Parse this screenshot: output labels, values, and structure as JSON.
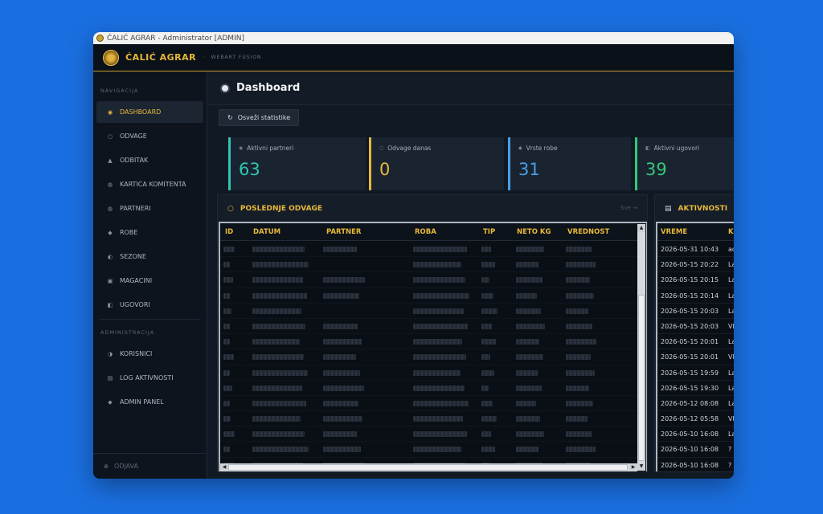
{
  "window": {
    "title": "ĆALIĆ AGRAR - Administrator [ADMIN]"
  },
  "header": {
    "brand": "ĆALIĆ AGRAR",
    "separator": "·",
    "subtitle": "WEBART FUSION"
  },
  "sidebar": {
    "section_nav": "NAVIGACIJA",
    "nav_items": [
      {
        "label": "DASHBOARD",
        "icon": "◉",
        "active": true
      },
      {
        "label": "ODVAGE",
        "icon": "○"
      },
      {
        "label": "ODBITAK",
        "icon": "▲"
      },
      {
        "label": "KARTICA KOMITENTA",
        "icon": "◍"
      },
      {
        "label": "PARTNERI",
        "icon": "◍"
      },
      {
        "label": "ROBE",
        "icon": "◆"
      },
      {
        "label": "SEZONE",
        "icon": "◐"
      },
      {
        "label": "MAGACINI",
        "icon": "▣"
      },
      {
        "label": "UGOVORI",
        "icon": "◧"
      }
    ],
    "section_admin": "ADMINISTRACIJA",
    "admin_items": [
      {
        "label": "KORISNICI",
        "icon": "◑"
      },
      {
        "label": "LOG AKTIVNOSTI",
        "icon": "▤"
      },
      {
        "label": "ADMIN PANEL",
        "icon": "◆"
      }
    ],
    "logout": "ODJAVA"
  },
  "page": {
    "title": "Dashboard",
    "refresh_label": "Osveži statistike"
  },
  "stats": [
    {
      "label": "Aktivni partneri",
      "value": "63",
      "color": "#2fc4b2"
    },
    {
      "label": "Odvage danas",
      "value": "0",
      "color": "#e8b83a"
    },
    {
      "label": "Vrste robe",
      "value": "31",
      "color": "#4a9ee8"
    },
    {
      "label": "Aktivni ugovori",
      "value": "39",
      "color": "#34c77b"
    }
  ],
  "recent_panel": {
    "title": "POSLEDNJE ODVAGE",
    "more": "Sve →",
    "columns": [
      "ID",
      "DATUM",
      "PARTNER",
      "ROBA",
      "TIP",
      "NETO KG",
      "VREDNOST"
    ]
  },
  "activity_panel": {
    "title": "AKTIVNOSTI",
    "columns": [
      "VREME",
      "K"
    ],
    "rows": [
      {
        "time": "2026-05-31 10:43",
        "user": "ad"
      },
      {
        "time": "2026-05-15 20:22",
        "user": "La"
      },
      {
        "time": "2026-05-15 20:15",
        "user": "La"
      },
      {
        "time": "2026-05-15 20:14",
        "user": "La"
      },
      {
        "time": "2026-05-15 20:03",
        "user": "La"
      },
      {
        "time": "2026-05-15 20:03",
        "user": "Vla"
      },
      {
        "time": "2026-05-15 20:01",
        "user": "La"
      },
      {
        "time": "2026-05-15 20:01",
        "user": "Vla"
      },
      {
        "time": "2026-05-15 19:59",
        "user": "La"
      },
      {
        "time": "2026-05-15 19:30",
        "user": "La"
      },
      {
        "time": "2026-05-12 08:08",
        "user": "La"
      },
      {
        "time": "2026-05-12 05:58",
        "user": "Vla"
      },
      {
        "time": "2026-05-10 16:08",
        "user": "La"
      },
      {
        "time": "2026-05-10 16:08",
        "user": "?"
      },
      {
        "time": "2026-05-10 16:08",
        "user": "?"
      }
    ]
  }
}
